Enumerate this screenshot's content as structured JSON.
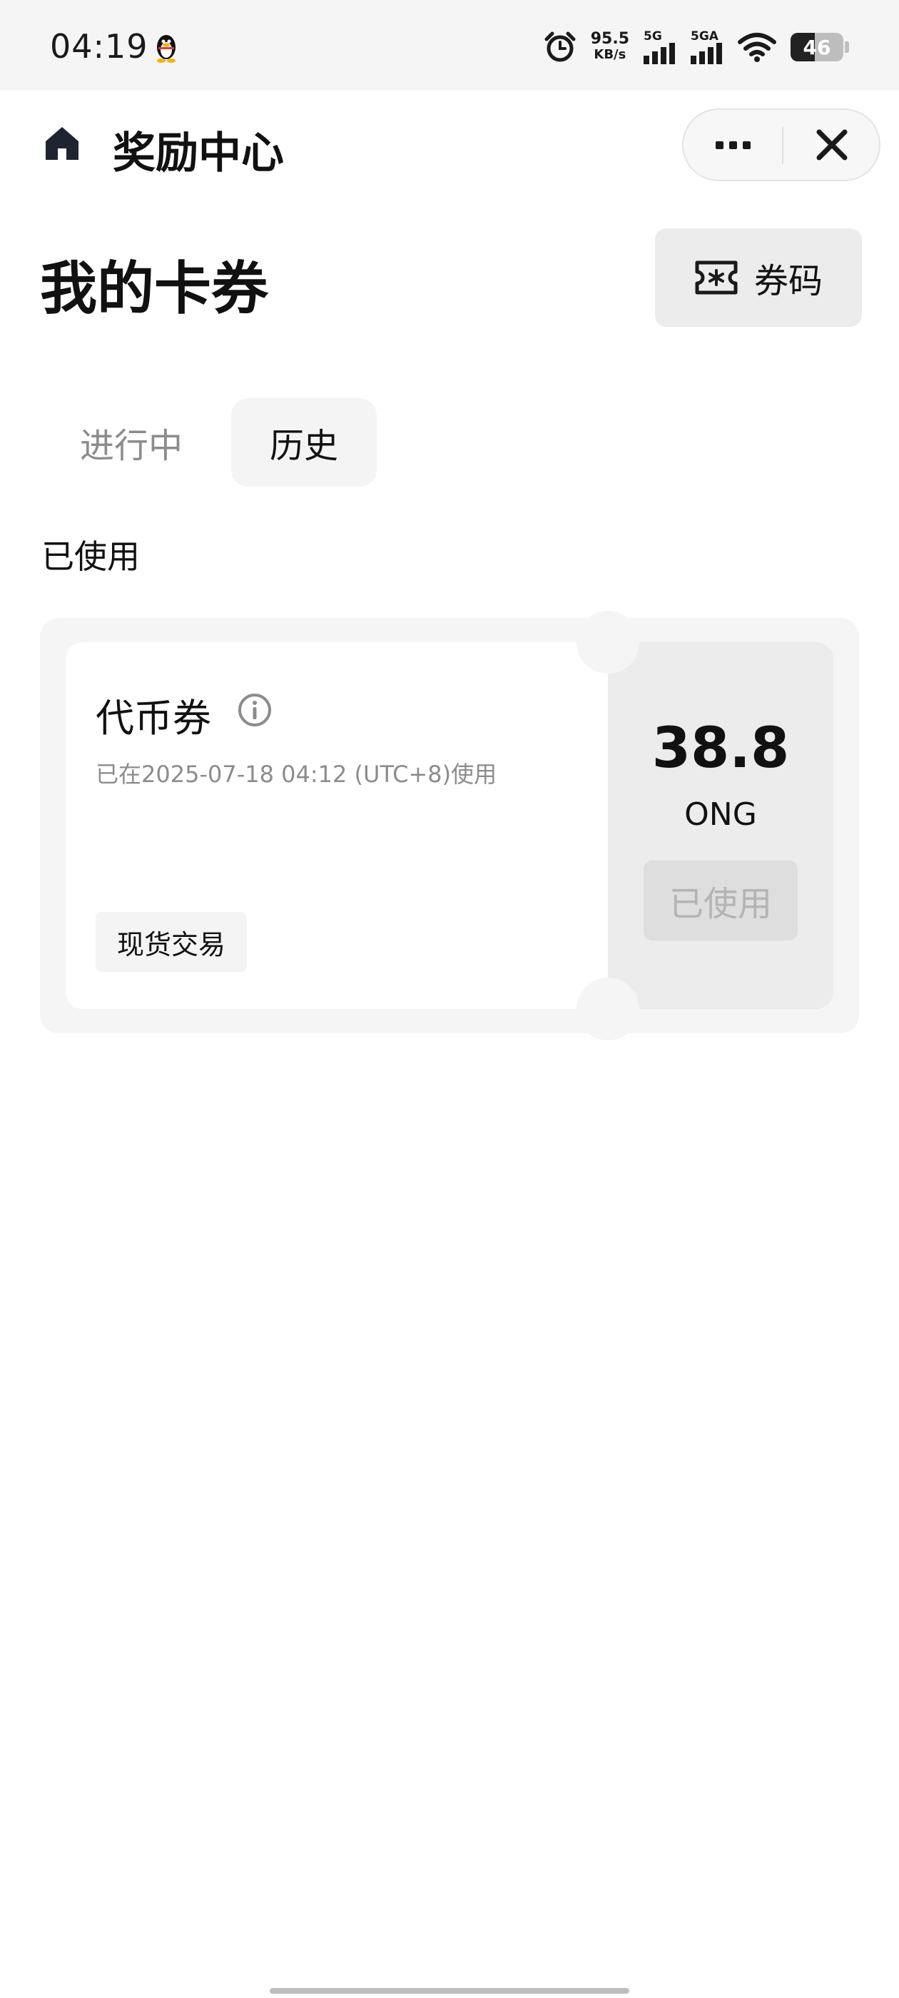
{
  "status_bar": {
    "time": "04:19",
    "net_speed_value": "95.5",
    "net_speed_unit": "KB/s",
    "signal1_label": "5G",
    "signal2_label": "5GA",
    "battery": "46",
    "battery_level": 46
  },
  "header": {
    "title": "奖励中心"
  },
  "page": {
    "title": "我的卡券",
    "code_button_label": "券码"
  },
  "tabs": [
    {
      "label": "进行中",
      "active": false
    },
    {
      "label": "历史",
      "active": true
    }
  ],
  "section_label": "已使用",
  "coupon": {
    "name": "代币券",
    "used_time": "已在2025-07-18 04:12 (UTC+8)使用",
    "scope_tag": "现货交易",
    "amount": "38.8",
    "unit": "ONG",
    "status_button": "已使用"
  },
  "colors": {
    "text_primary": "#111111",
    "text_secondary": "#8c8c8c",
    "disabled_text": "#b4b4b4",
    "card_bg": "#f5f5f5"
  }
}
